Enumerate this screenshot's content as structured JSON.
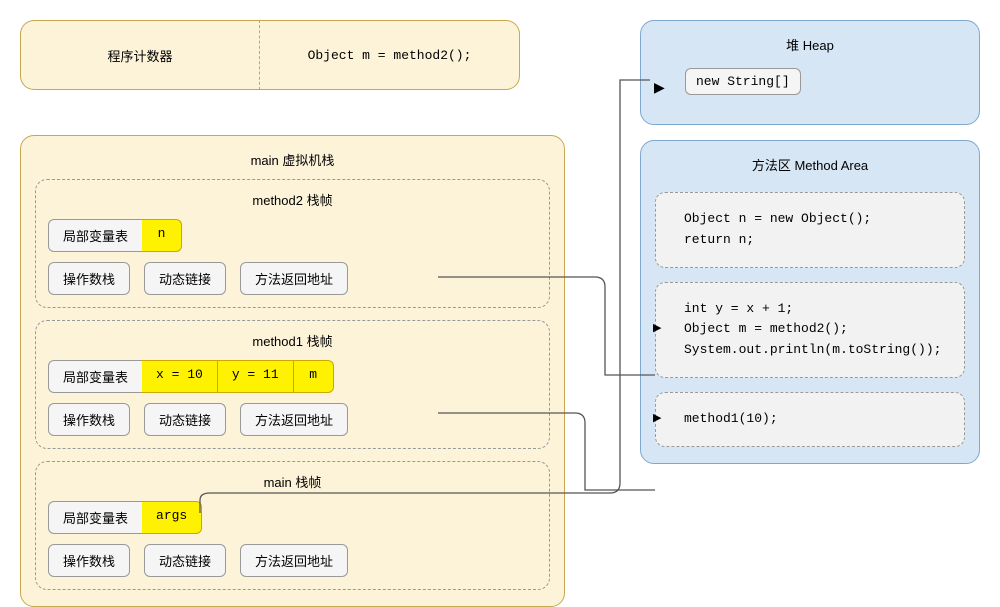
{
  "pc": {
    "title": "程序计数器",
    "code": "Object m = method2();"
  },
  "heap": {
    "title": "堆 Heap",
    "item": "new String[]"
  },
  "vmstack": {
    "title": "main 虚拟机栈",
    "labels": {
      "lvt": "局部变量表",
      "opstack": "操作数栈",
      "dynlink": "动态链接",
      "retaddr": "方法返回地址"
    },
    "frames": [
      {
        "title": "method2 栈帧",
        "vars": [
          "n"
        ]
      },
      {
        "title": "method1 栈帧",
        "vars": [
          "x = 10",
          "y = 11",
          "m"
        ]
      },
      {
        "title": "main 栈帧",
        "vars": [
          "args"
        ]
      }
    ]
  },
  "methodArea": {
    "title": "方法区 Method Area",
    "blocks": [
      {
        "lines": [
          "Object n = new Object();",
          "return n;"
        ]
      },
      {
        "lines": [
          "int y = x + 1;",
          "Object m = method2();",
          "System.out.println(m.toString());"
        ]
      },
      {
        "lines": [
          "method1(10);"
        ]
      }
    ]
  }
}
